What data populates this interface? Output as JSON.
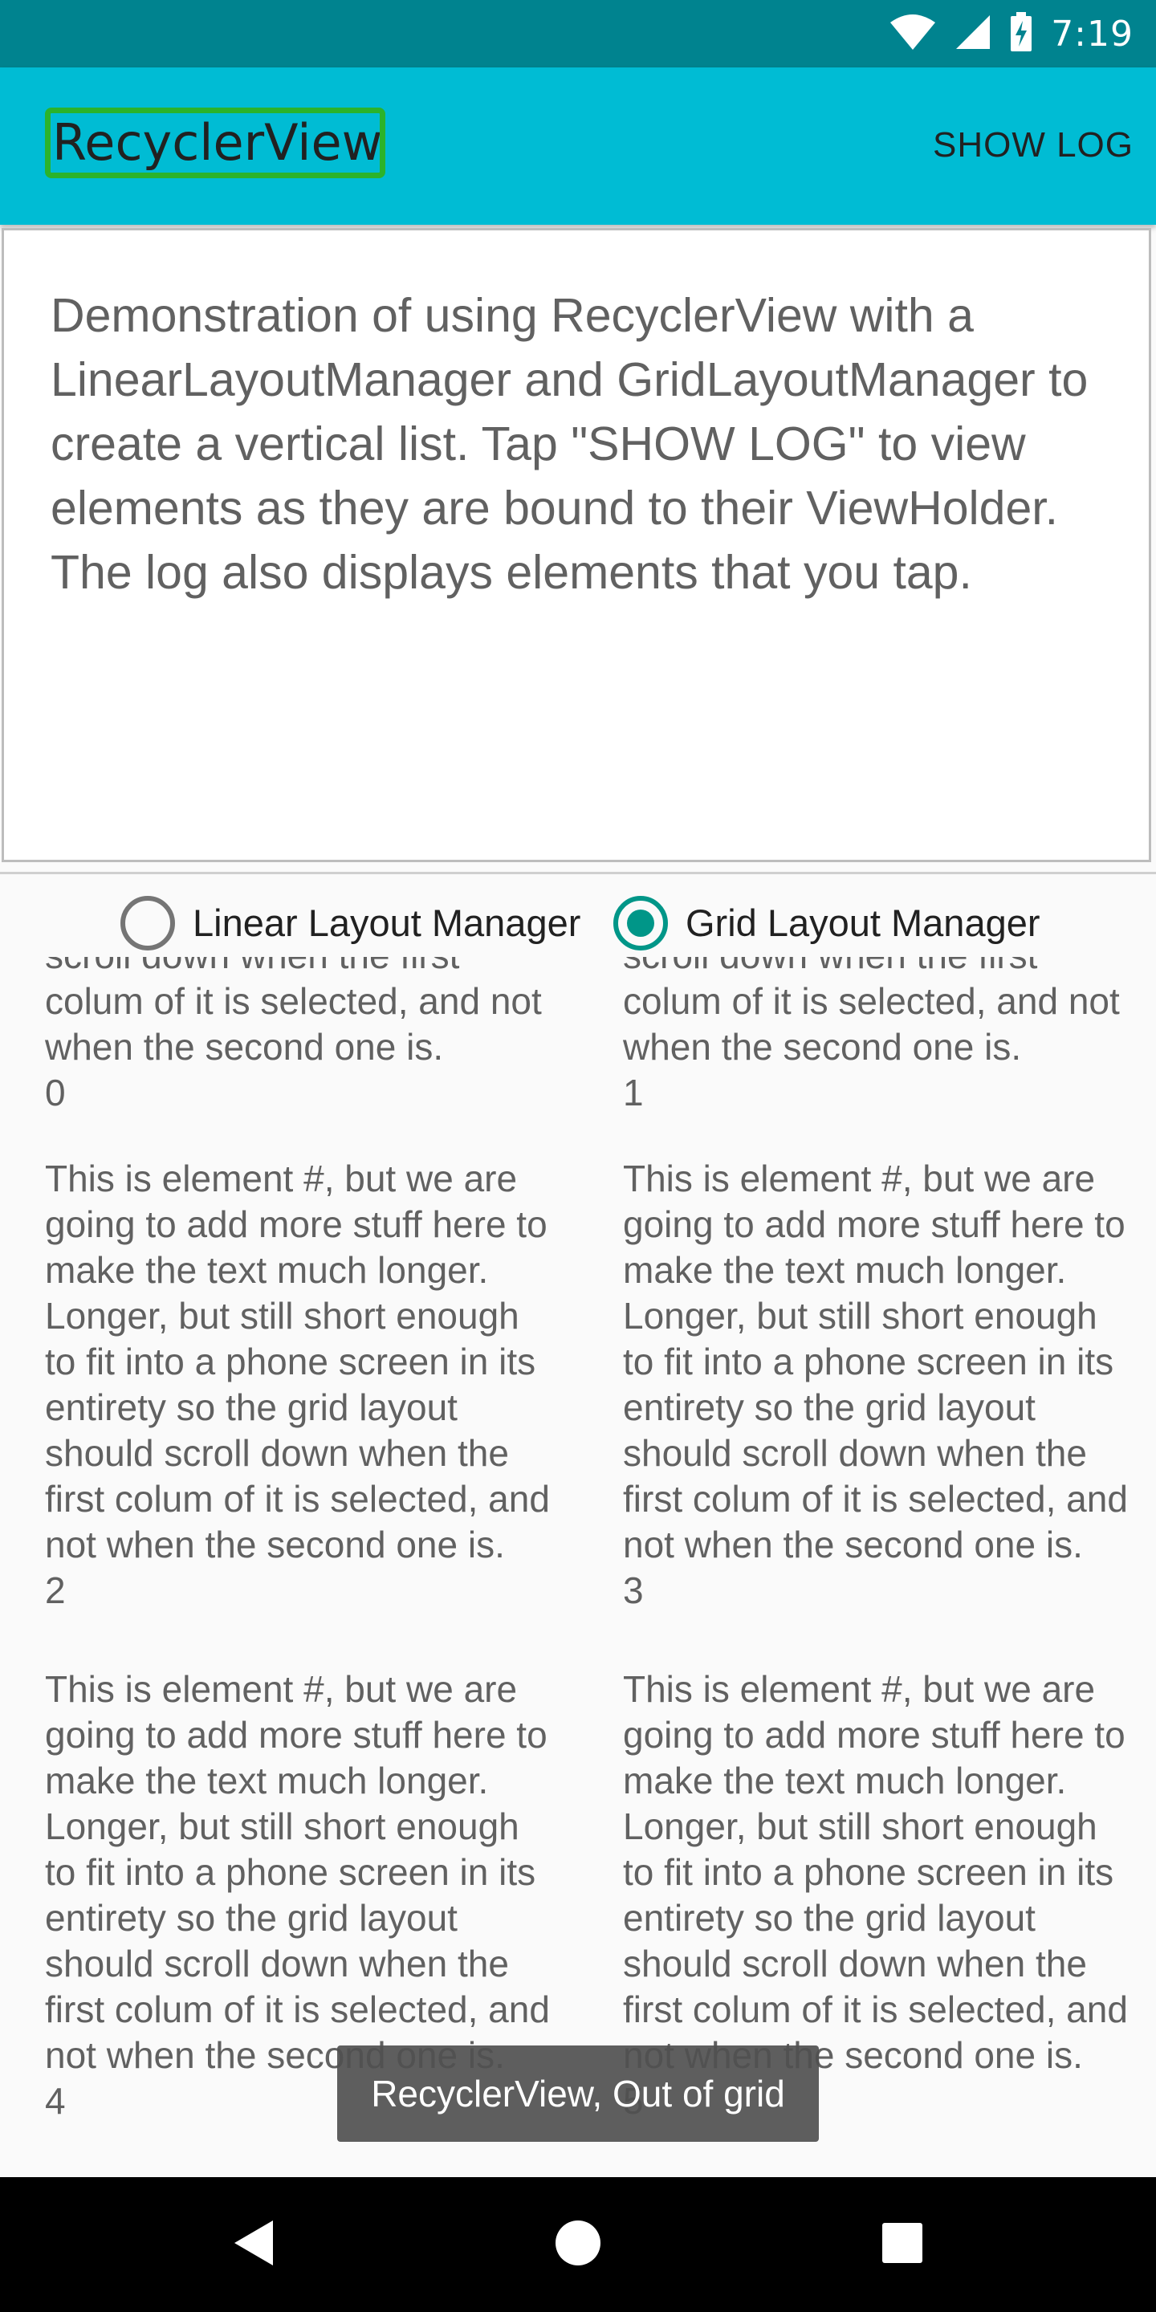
{
  "status_bar": {
    "time": "7:19",
    "icons": [
      "wifi-icon",
      "cell-signal-icon",
      "battery-charging-icon"
    ],
    "background": "#00838f"
  },
  "app_bar": {
    "title": "RecyclerView",
    "action": "SHOW LOG",
    "background": "#00bcd4"
  },
  "description": "Demonstration of using RecyclerView with a LinearLayoutManager and GridLayoutManager to create a vertical list. Tap \"SHOW LOG\" to view elements as they are bound to their ViewHolder. The log also displays elements that you tap.",
  "layout_options": {
    "linear_label": "Linear Layout Manager",
    "grid_label": "Grid Layout Manager",
    "selected": "grid",
    "accent": "#009688"
  },
  "grid": {
    "partial_tail": "scroll down when the first colum of it is selected, and not when the second one is.",
    "element_text": "This is element #, but we are going to add more stuff here to make the text much longer. Longer, but still short enough to fit into a phone screen in its entirety so the grid layout should scroll down when the first colum of it is selected, and not when the second one is.",
    "items": [
      {
        "number": "0"
      },
      {
        "number": "1"
      },
      {
        "number": "2"
      },
      {
        "number": "3"
      },
      {
        "number": "4"
      },
      {
        "number": "5"
      }
    ]
  },
  "toast": {
    "message": "RecyclerView, Out of grid"
  },
  "nav_bar": {
    "buttons": [
      "back-icon",
      "home-icon",
      "recents-icon"
    ]
  }
}
